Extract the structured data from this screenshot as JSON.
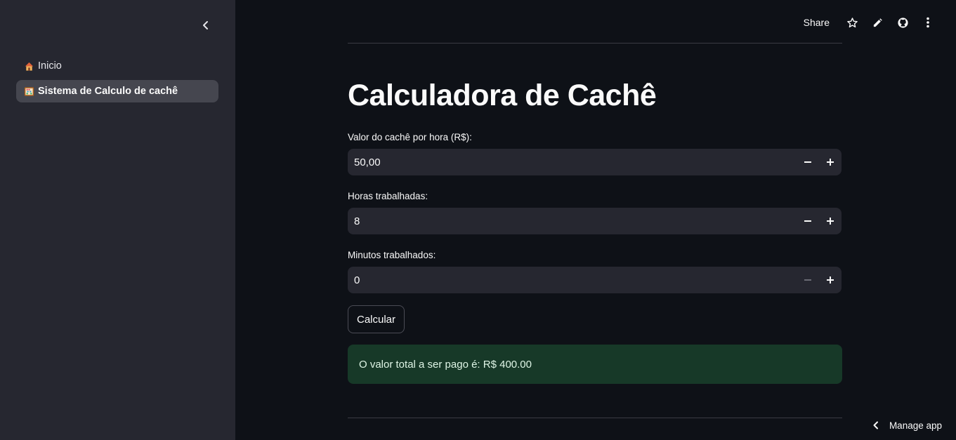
{
  "sidebar": {
    "items": [
      {
        "label": "Inicio",
        "icon": "house-icon",
        "active": false
      },
      {
        "label": "Sistema de Calculo de cachê",
        "icon": "abacus-icon",
        "active": true
      }
    ]
  },
  "toolbar": {
    "share_label": "Share",
    "icons": [
      "star-icon",
      "pencil-icon",
      "github-icon",
      "more-vertical-icon"
    ]
  },
  "main": {
    "title": "Calculadora de Cachê",
    "fields": [
      {
        "label": "Valor do cachê por hora (R$):",
        "value": "50,00"
      },
      {
        "label": "Horas trabalhadas:",
        "value": "8"
      },
      {
        "label": "Minutos trabalhados:",
        "value": "0"
      }
    ],
    "calculate_label": "Calcular",
    "result_text": "O valor total a ser pago é: R$ 400.00"
  },
  "footer": {
    "manage_label": "Manage app"
  },
  "colors": {
    "background": "#0e1117",
    "sidebar": "#262730",
    "input": "#262730",
    "success_bg": "#173928"
  }
}
